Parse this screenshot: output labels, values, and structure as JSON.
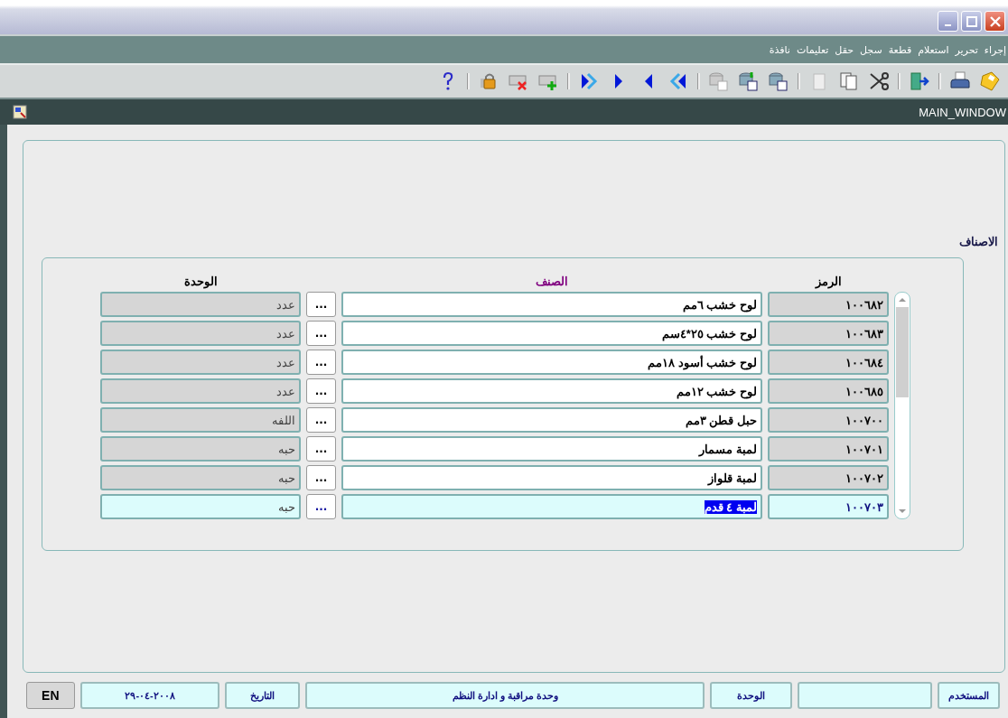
{
  "menu": [
    "إجراء",
    "تحرير",
    "استعلام",
    "قطعة",
    "سجل",
    "حقل",
    "تعليمات",
    "نافذة"
  ],
  "inner_window": {
    "title": "MAIN_WINDOW"
  },
  "section_title": "الاصناف",
  "table": {
    "columns": [
      {
        "label": "الرمز",
        "color": "#000000"
      },
      {
        "label": "الصنف",
        "color": "#800080"
      },
      {
        "label": "الوحدة",
        "color": "#000000"
      }
    ],
    "rows": [
      {
        "code": "١٠٠٦٨٢",
        "name": "لوح خشب ٦مم",
        "button": "...",
        "unit": "عدد",
        "selected": false
      },
      {
        "code": "١٠٠٦٨٣",
        "name": "لوح خشب ٢٥*٤سم",
        "button": "...",
        "unit": "عدد",
        "selected": false
      },
      {
        "code": "١٠٠٦٨٤",
        "name": "لوح خشب أسود ١٨مم",
        "button": "...",
        "unit": "عدد",
        "selected": false
      },
      {
        "code": "١٠٠٦٨٥",
        "name": "لوح خشب ١٢مم",
        "button": "...",
        "unit": "عدد",
        "selected": false
      },
      {
        "code": "١٠٠٧٠٠",
        "name": "حبل قطن ٣مم",
        "button": "...",
        "unit": "اللفه",
        "selected": false
      },
      {
        "code": "١٠٠٧٠١",
        "name": "لمبة مسمار",
        "button": "...",
        "unit": "حبه",
        "selected": false
      },
      {
        "code": "١٠٠٧٠٢",
        "name": "لمبة قلواز",
        "button": "...",
        "unit": "حبه",
        "selected": false
      },
      {
        "code": "١٠٠٧٠٣",
        "name": "لمبة ٤ قدم",
        "button": "...",
        "unit": "حبه",
        "selected": true
      }
    ]
  },
  "status_bar": [
    {
      "kind": "field",
      "text": "المستخدم"
    },
    {
      "kind": "field"
    },
    {
      "kind": "field",
      "text": "الوحدة"
    },
    {
      "kind": "field",
      "text": "وحدة مراقبة و ادارة النظم"
    },
    {
      "kind": "field",
      "text": "التاريخ"
    },
    {
      "kind": "field",
      "text": "٢٠٠٨-٠٤-٢٩"
    },
    {
      "kind": "button",
      "text": "EN"
    }
  ]
}
